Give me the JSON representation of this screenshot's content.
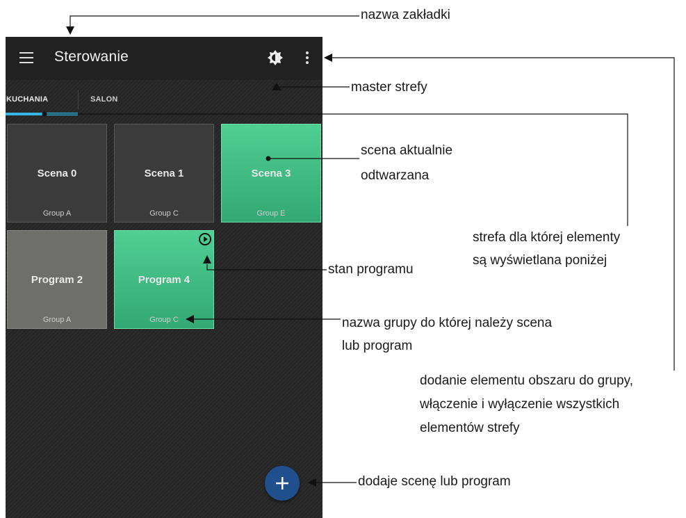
{
  "app": {
    "title": "Sterowanie",
    "icons": {
      "menu": "hamburger-menu-icon",
      "master": "brightness-icon",
      "more": "more-vert-icon",
      "play": "play-circle-icon",
      "add": "plus-icon"
    },
    "colors": {
      "accent_tab": "#33b5e5",
      "active_tile": "#3fbf85",
      "fab": "#1f4f8c"
    }
  },
  "tabs": [
    {
      "label": "KUCHANIA",
      "selected": true
    },
    {
      "label": "SALON",
      "selected": false
    }
  ],
  "tiles": [
    {
      "name": "Scena 0",
      "group": "Group A",
      "state": "idle"
    },
    {
      "name": "Scena 1",
      "group": "Group C",
      "state": "idle"
    },
    {
      "name": "Scena 3",
      "group": "Group E",
      "state": "playing"
    },
    {
      "name": "Program 2",
      "group": "Group A",
      "state": "inactive"
    },
    {
      "name": "Program 4",
      "group": "Group C",
      "state": "running"
    }
  ],
  "annotations": {
    "tab_name": "nazwa zakładki",
    "master": "master strefy",
    "scene_line1": "scena  aktualnie",
    "scene_line2": "odtwarzana",
    "zone_line1": "strefa dla której elementy",
    "zone_line2": "są wyświetlana poniżej",
    "program_state": "stan programu",
    "group_line1": "nazwa grupy do której należy scena",
    "group_line2": "lub program",
    "menu_line1": "dodanie elementu obszaru do grupy,",
    "menu_line2": "włączenie  i  wyłączenie  wszystkich",
    "menu_line3": "elementów strefy",
    "fab": "dodaje scenę lub program"
  }
}
